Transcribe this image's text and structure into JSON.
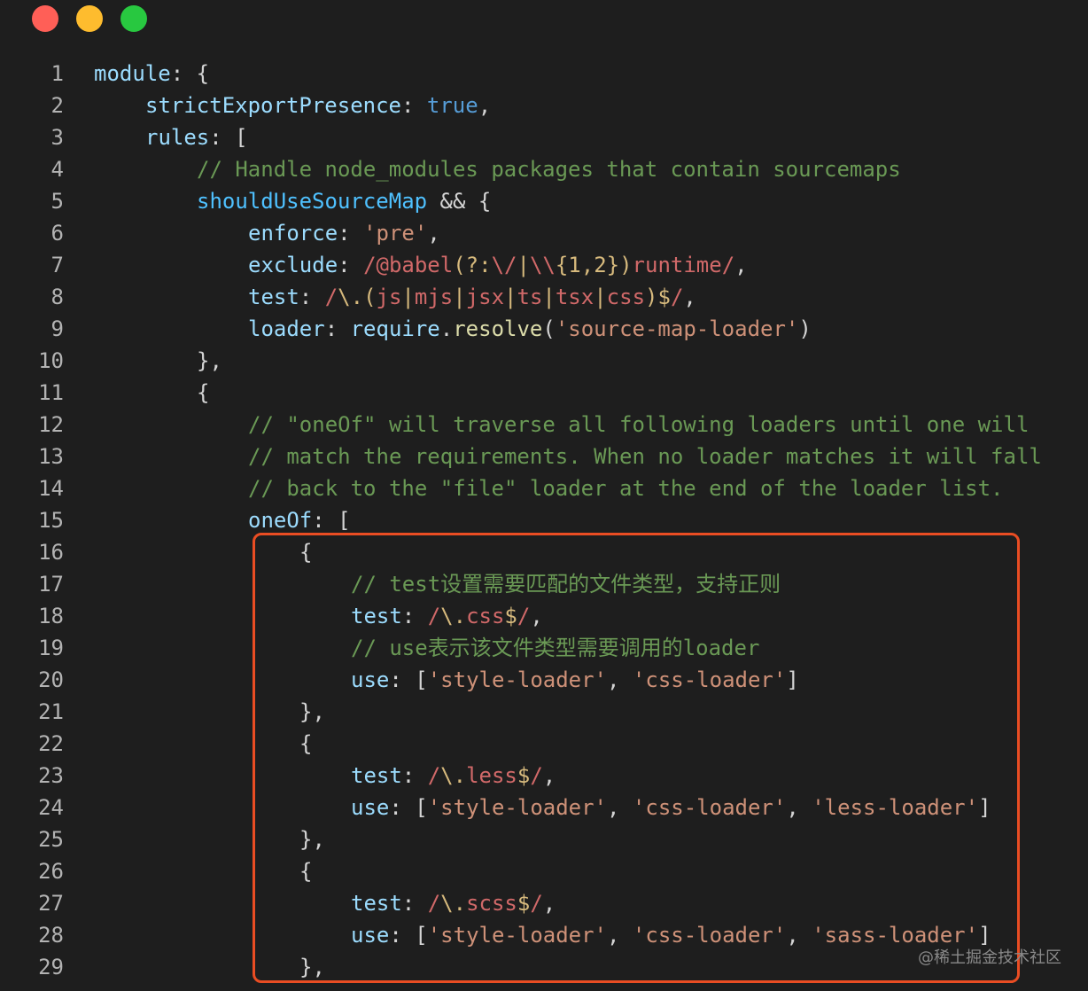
{
  "window": {
    "controls": [
      {
        "name": "close",
        "color": "#ff5f57"
      },
      {
        "name": "minimize",
        "color": "#febc2e"
      },
      {
        "name": "zoom",
        "color": "#28c840"
      }
    ]
  },
  "lines": [
    {
      "n": "1",
      "indent": 0,
      "tokens": [
        [
          "prop",
          "module"
        ],
        [
          "op",
          ": {"
        ]
      ]
    },
    {
      "n": "2",
      "indent": 1,
      "tokens": [
        [
          "prop",
          "strictExportPresence"
        ],
        [
          "op",
          ": "
        ],
        [
          "kw",
          "true"
        ],
        [
          "op",
          ","
        ]
      ]
    },
    {
      "n": "3",
      "indent": 1,
      "tokens": [
        [
          "prop",
          "rules"
        ],
        [
          "op",
          ": ["
        ]
      ]
    },
    {
      "n": "4",
      "indent": 2,
      "tokens": [
        [
          "cm",
          "// Handle node_modules packages that contain sourcemaps"
        ]
      ]
    },
    {
      "n": "5",
      "indent": 2,
      "tokens": [
        [
          "var",
          "shouldUseSourceMap"
        ],
        [
          "op",
          " && {"
        ]
      ]
    },
    {
      "n": "6",
      "indent": 3,
      "tokens": [
        [
          "prop",
          "enforce"
        ],
        [
          "op",
          ": "
        ],
        [
          "str",
          "'pre'"
        ],
        [
          "op",
          ","
        ]
      ]
    },
    {
      "n": "7",
      "indent": 3,
      "tokens": [
        [
          "prop",
          "exclude"
        ],
        [
          "op",
          ": "
        ],
        [
          "re",
          "/@babel"
        ],
        [
          "rx",
          "(?:"
        ],
        [
          "re",
          "\\/"
        ],
        [
          "rx",
          "|"
        ],
        [
          "re",
          "\\\\"
        ],
        [
          "rx",
          "{1,2}"
        ],
        [
          "rx",
          ")"
        ],
        [
          "re",
          "runtime/"
        ],
        [
          "op",
          ","
        ]
      ]
    },
    {
      "n": "8",
      "indent": 3,
      "tokens": [
        [
          "prop",
          "test"
        ],
        [
          "op",
          ": "
        ],
        [
          "re",
          "/"
        ],
        [
          "rx",
          "\\."
        ],
        [
          "rx",
          "("
        ],
        [
          "re",
          "js"
        ],
        [
          "rx",
          "|"
        ],
        [
          "re",
          "mjs"
        ],
        [
          "rx",
          "|"
        ],
        [
          "re",
          "jsx"
        ],
        [
          "rx",
          "|"
        ],
        [
          "re",
          "ts"
        ],
        [
          "rx",
          "|"
        ],
        [
          "re",
          "tsx"
        ],
        [
          "rx",
          "|"
        ],
        [
          "re",
          "css"
        ],
        [
          "rx",
          ")"
        ],
        [
          "rx",
          "$"
        ],
        [
          "re",
          "/"
        ],
        [
          "op",
          ","
        ]
      ]
    },
    {
      "n": "9",
      "indent": 3,
      "tokens": [
        [
          "prop",
          "loader"
        ],
        [
          "op",
          ": "
        ],
        [
          "prop",
          "require"
        ],
        [
          "op",
          "."
        ],
        [
          "fn",
          "resolve"
        ],
        [
          "op",
          "("
        ],
        [
          "str",
          "'source-map-loader'"
        ],
        [
          "op",
          ")"
        ]
      ]
    },
    {
      "n": "10",
      "indent": 2,
      "tokens": [
        [
          "op",
          "},"
        ]
      ]
    },
    {
      "n": "11",
      "indent": 2,
      "tokens": [
        [
          "op",
          "{"
        ]
      ]
    },
    {
      "n": "12",
      "indent": 3,
      "tokens": [
        [
          "cm",
          "// \"oneOf\" will traverse all following loaders until one will"
        ]
      ]
    },
    {
      "n": "13",
      "indent": 3,
      "tokens": [
        [
          "cm",
          "// match the requirements. When no loader matches it will fall"
        ]
      ]
    },
    {
      "n": "14",
      "indent": 3,
      "tokens": [
        [
          "cm",
          "// back to the \"file\" loader at the end of the loader list."
        ]
      ]
    },
    {
      "n": "15",
      "indent": 3,
      "tokens": [
        [
          "prop",
          "oneOf"
        ],
        [
          "op",
          ": ["
        ]
      ]
    },
    {
      "n": "16",
      "indent": 4,
      "tokens": [
        [
          "op",
          "{"
        ]
      ]
    },
    {
      "n": "17",
      "indent": 5,
      "tokens": [
        [
          "cm",
          "// test设置需要匹配的文件类型，支持正则"
        ]
      ]
    },
    {
      "n": "18",
      "indent": 5,
      "tokens": [
        [
          "prop",
          "test"
        ],
        [
          "op",
          ": "
        ],
        [
          "re",
          "/"
        ],
        [
          "rx",
          "\\."
        ],
        [
          "re",
          "css"
        ],
        [
          "rx",
          "$"
        ],
        [
          "re",
          "/"
        ],
        [
          "op",
          ","
        ]
      ]
    },
    {
      "n": "19",
      "indent": 5,
      "tokens": [
        [
          "cm",
          "// use表示该文件类型需要调用的loader"
        ]
      ]
    },
    {
      "n": "20",
      "indent": 5,
      "tokens": [
        [
          "prop",
          "use"
        ],
        [
          "op",
          ": ["
        ],
        [
          "str",
          "'style-loader'"
        ],
        [
          "op",
          ", "
        ],
        [
          "str",
          "'css-loader'"
        ],
        [
          "op",
          "]"
        ]
      ]
    },
    {
      "n": "21",
      "indent": 4,
      "tokens": [
        [
          "op",
          "},"
        ]
      ]
    },
    {
      "n": "22",
      "indent": 4,
      "tokens": [
        [
          "op",
          "{"
        ]
      ]
    },
    {
      "n": "23",
      "indent": 5,
      "tokens": [
        [
          "prop",
          "test"
        ],
        [
          "op",
          ": "
        ],
        [
          "re",
          "/"
        ],
        [
          "rx",
          "\\."
        ],
        [
          "re",
          "less"
        ],
        [
          "rx",
          "$"
        ],
        [
          "re",
          "/"
        ],
        [
          "op",
          ","
        ]
      ]
    },
    {
      "n": "24",
      "indent": 5,
      "tokens": [
        [
          "prop",
          "use"
        ],
        [
          "op",
          ": ["
        ],
        [
          "str",
          "'style-loader'"
        ],
        [
          "op",
          ", "
        ],
        [
          "str",
          "'css-loader'"
        ],
        [
          "op",
          ", "
        ],
        [
          "str",
          "'less-loader'"
        ],
        [
          "op",
          "]"
        ]
      ]
    },
    {
      "n": "25",
      "indent": 4,
      "tokens": [
        [
          "op",
          "},"
        ]
      ]
    },
    {
      "n": "26",
      "indent": 4,
      "tokens": [
        [
          "op",
          "{"
        ]
      ]
    },
    {
      "n": "27",
      "indent": 5,
      "tokens": [
        [
          "prop",
          "test"
        ],
        [
          "op",
          ": "
        ],
        [
          "re",
          "/"
        ],
        [
          "rx",
          "\\."
        ],
        [
          "re",
          "scss"
        ],
        [
          "rx",
          "$"
        ],
        [
          "re",
          "/"
        ],
        [
          "op",
          ","
        ]
      ]
    },
    {
      "n": "28",
      "indent": 5,
      "tokens": [
        [
          "prop",
          "use"
        ],
        [
          "op",
          ": ["
        ],
        [
          "str",
          "'style-loader'"
        ],
        [
          "op",
          ", "
        ],
        [
          "str",
          "'css-loader'"
        ],
        [
          "op",
          ", "
        ],
        [
          "str",
          "'sass-loader'"
        ],
        [
          "op",
          "]"
        ]
      ]
    },
    {
      "n": "29",
      "indent": 4,
      "tokens": [
        [
          "op",
          "},"
        ]
      ]
    }
  ],
  "highlight": {
    "color": "#ea4d23"
  },
  "watermark": "@稀土掘金技术社区"
}
